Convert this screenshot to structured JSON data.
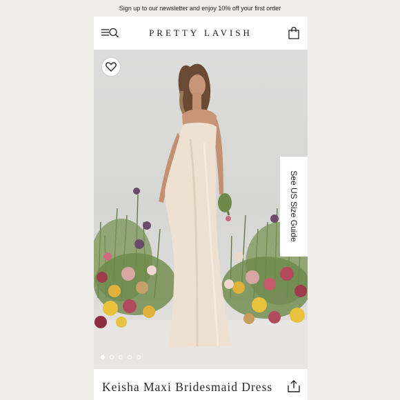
{
  "banner": {
    "text": "Sign up to our newsletter and enjoy 10% off your first order"
  },
  "header": {
    "logo": "PRETTY LAVISH",
    "menu_icon": "menu-icon",
    "search_icon": "search-icon",
    "cart_icon": "shopping-bag-icon"
  },
  "gallery": {
    "favorite_icon": "heart-icon",
    "size_guide_label": "See US Size Guide",
    "image_count": 5,
    "active_index": 0
  },
  "product": {
    "title": "Keisha Maxi Bridesmaid Dress",
    "share_icon": "share-icon"
  },
  "colors": {
    "dress": "#efe1d2",
    "background": "#d9d9d7",
    "page": "#f0eeeb"
  }
}
